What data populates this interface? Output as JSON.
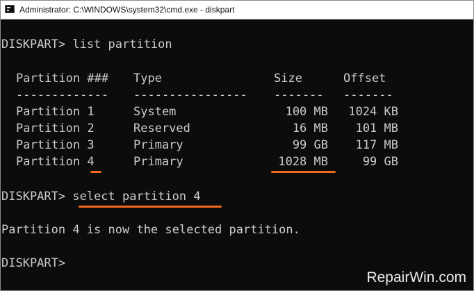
{
  "window": {
    "title": "Administrator: C:\\WINDOWS\\system32\\cmd.exe - diskpart"
  },
  "terminal": {
    "cmd1": "DISKPART> list partition",
    "header": [
      "Partition ###",
      "Type",
      "Size",
      "Offset"
    ],
    "separator": [
      "-------------",
      "----------------",
      "-------",
      "-------"
    ],
    "rows": [
      {
        "partition": "Partition 1",
        "type": "System",
        "size": "100 MB",
        "offset": "1024 KB"
      },
      {
        "partition": "Partition 2",
        "type": "Reserved",
        "size": "16 MB",
        "offset": "101 MB"
      },
      {
        "partition": "Partition 3",
        "type": "Primary",
        "size": "99 GB",
        "offset": "117 MB"
      },
      {
        "partition": "Partition 4",
        "type": "Primary",
        "size": "1028 MB",
        "offset": "99 GB"
      }
    ],
    "prompt2": "DISKPART> ",
    "cmd2": "select partition 4",
    "result": "Partition 4 is now the selected partition.",
    "prompt3": "DISKPART>"
  },
  "watermark": "RepairWin.com",
  "colors": {
    "terminal_bg": "#0c0c0c",
    "terminal_text": "#cccccc",
    "highlight_underline": "#f26a1b"
  }
}
